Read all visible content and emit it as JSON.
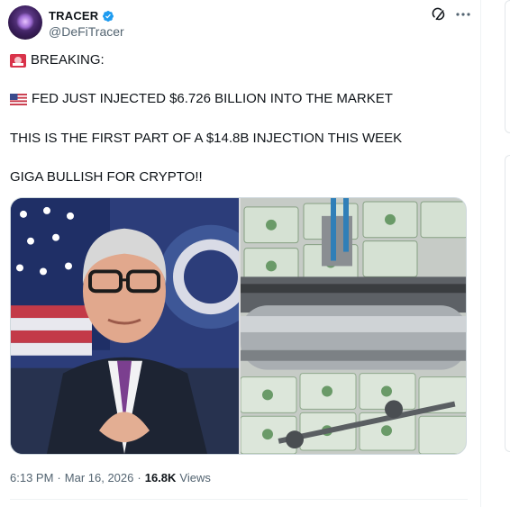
{
  "author": {
    "name": "TRACER",
    "handle": "@DeFiTracer",
    "verified": true
  },
  "icons": {
    "verified": "verified-badge-icon",
    "grok": "grok-icon",
    "more": "more-options-icon",
    "siren": "police-light-emoji",
    "flag": "us-flag-emoji"
  },
  "tweet": {
    "line1": "BREAKING:",
    "line2": "FED JUST INJECTED $6.726 BILLION INTO THE MARKET",
    "line3": "THIS IS THE FIRST PART OF A $14.8B INJECTION THIS WEEK",
    "line4": "GIGA BULLISH FOR CRYPTO!!"
  },
  "meta": {
    "time": "6:13 PM",
    "separator1": "·",
    "date": "Mar 16, 2026",
    "separator2": "·",
    "views_count": "16.8K",
    "views_label": "Views"
  },
  "colors": {
    "verified": "#1d9bf0",
    "text": "#0f1419",
    "secondary": "#536471"
  }
}
